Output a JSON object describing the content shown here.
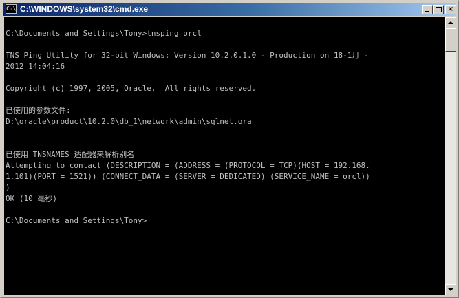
{
  "window": {
    "title": "C:\\WINDOWS\\system32\\cmd.exe",
    "icon_text": "C:\\",
    "buttons": {
      "minimize": "minimize-icon",
      "maximize": "maximize-icon",
      "close": "×"
    }
  },
  "console": {
    "lines": [
      "",
      "C:\\Documents and Settings\\Tony>tnsping orcl",
      "",
      "TNS Ping Utility for 32-bit Windows: Version 10.2.0.1.0 - Production on 18-1月 -",
      "2012 14:04:16",
      "",
      "Copyright (c) 1997, 2005, Oracle.  All rights reserved.",
      "",
      "已使用的参数文件:",
      "D:\\oracle\\product\\10.2.0\\db_1\\network\\admin\\sqlnet.ora",
      "",
      "",
      "已使用 TNSNAMES 适配器来解析别名",
      "Attempting to contact (DESCRIPTION = (ADDRESS = (PROTOCOL = TCP)(HOST = 192.168.",
      "1.101)(PORT = 1521)) (CONNECT_DATA = (SERVER = DEDICATED) (SERVICE_NAME = orcl))",
      ")",
      "OK (10 毫秒)",
      "",
      "C:\\Documents and Settings\\Tony>"
    ]
  },
  "colors": {
    "console_bg": "#000000",
    "console_text": "#c0c0c0",
    "titlebar_start": "#0a246a",
    "titlebar_end": "#a6caf0"
  }
}
